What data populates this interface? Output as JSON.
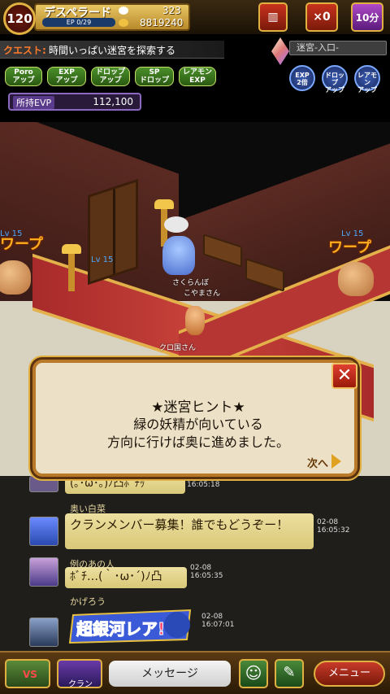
{
  "header": {
    "level": "120",
    "player_name": "デスペラード",
    "ep": "EP 0/29",
    "stones": "323",
    "gold": "8819240",
    "badge_count": "×0",
    "timer": "10分"
  },
  "quest": {
    "label": "クエスト:",
    "text": "時間いっぱい迷宮を探索する"
  },
  "location": "迷宮-入口-",
  "buffs": [
    {
      "line1": "Poro",
      "line2": "アップ"
    },
    {
      "line1": "EXP",
      "line2": "アップ"
    },
    {
      "line1": "ドロップ",
      "line2": "アップ"
    },
    {
      "line1": "SP",
      "line2": "ドロップ"
    },
    {
      "line1": "レアモン",
      "line2": "EXP"
    }
  ],
  "right_buffs": [
    {
      "line1": "EXP",
      "line2": "2倍"
    },
    {
      "line1": "ドロップ",
      "line2": "アップ"
    },
    {
      "line1": "レアモン",
      "line2": "アップ"
    }
  ],
  "evp": {
    "label": "所持EVP",
    "value": "112,100"
  },
  "scene": {
    "warp_left": "ワープ",
    "warp_right": "ワープ",
    "lv_left": "Lv 15",
    "lv_right": "Lv 15",
    "lv_door": "Lv 15",
    "npc_name": "さくらんぼ",
    "npc_guild": "こやまさん",
    "player_tag": "クロ国さん"
  },
  "dialog": {
    "title": "★迷宮ヒント★",
    "line1": "緑の妖精が向いている",
    "line2": "方向に行けば奥に進めました。",
    "next": "次へ"
  },
  "chat": [
    {
      "name": "",
      "message": "(｡･ω･｡)ﾉ凸ﾎﾞﾁｯ",
      "date": "",
      "time": "16:05:18"
    },
    {
      "name": "奥い白菜",
      "message": "クランメンバー募集！誰でもどうぞー！",
      "date": "02-08",
      "time": "16:05:32"
    },
    {
      "name": "例のあの人",
      "message": "ﾎﾞﾁ…(｀･ω･´)ﾉ凸",
      "date": "02-08",
      "time": "16:05:35"
    },
    {
      "name": "かげろう",
      "message": "超銀河レア!",
      "date": "02-08",
      "time": "16:07:01"
    }
  ],
  "bottom": {
    "vs_label": "VS",
    "clan_label": "クラン",
    "message_label": "メッセージ",
    "menu_label": "メニュー"
  }
}
